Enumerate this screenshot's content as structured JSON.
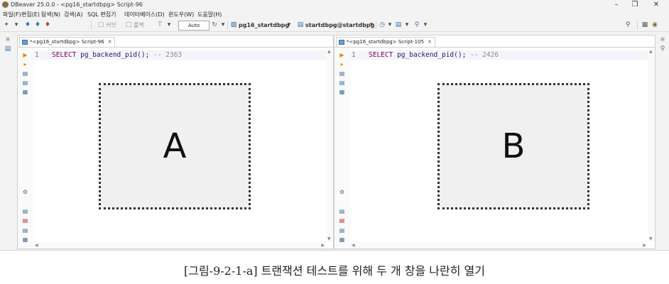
{
  "window": {
    "title": "DBeaver 25.0.0 - <pg16_startdbpg> Script-96"
  },
  "menu": [
    "파일(F)",
    "편집(E)",
    "탐색(N)",
    "검색(A)",
    "SQL 편집기",
    "데이터베이스(D)",
    "윈도우(W)",
    "도움말(H)"
  ],
  "toolbar": {
    "commit_label": "커밋",
    "rollback_label": "롤백",
    "transaction_mode": "Auto",
    "datasource": "pg16_startdbpg",
    "schema": "startdbpg@startdbpg"
  },
  "pane_left": {
    "tab_label": "*<pg16_startdbpg> Script-96",
    "line_number": "1",
    "code": {
      "keyword": "SELECT",
      "function": "pg_backend_pid",
      "punct": "();",
      "comment": "-- 2363"
    },
    "placeholder": "A"
  },
  "pane_right": {
    "tab_label": "*<pg16_startdbpg> Script-105",
    "line_number": "1",
    "code": {
      "keyword": "SELECT",
      "function": "pg_backend_pid",
      "punct": "();",
      "comment": "-- 2426"
    },
    "placeholder": "B"
  },
  "caption": "[그림-9-2-1-a] 트랜잭션 테스트를 위해 두 개 창을 나란히 열기"
}
